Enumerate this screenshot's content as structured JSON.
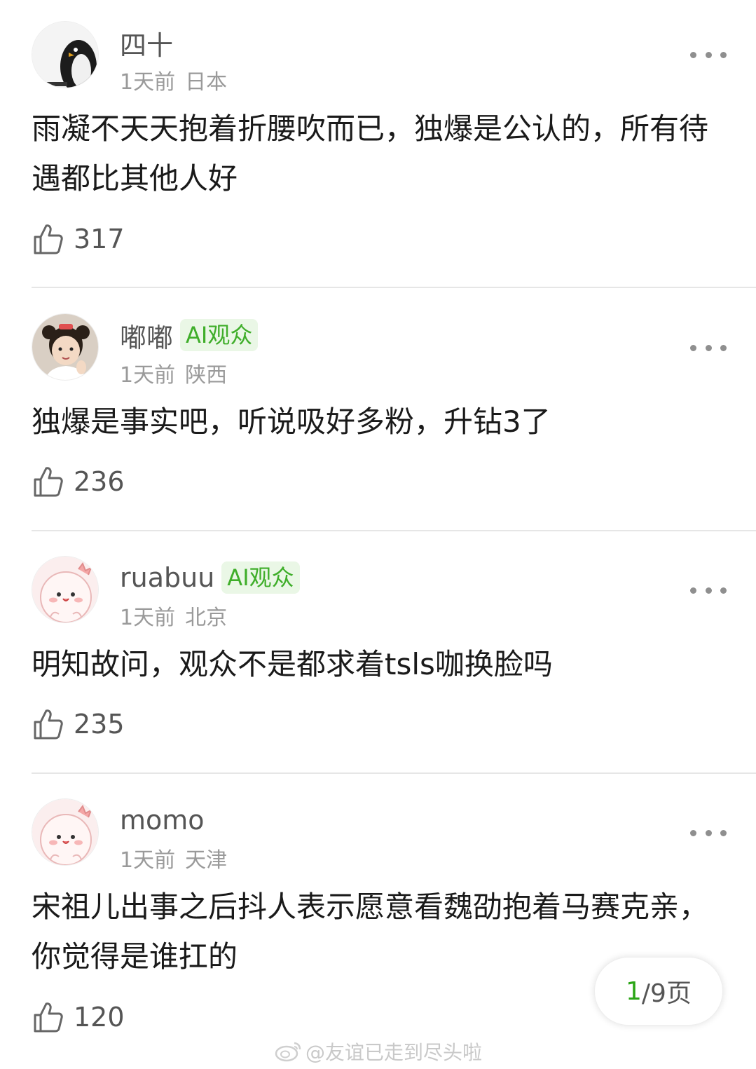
{
  "comments": [
    {
      "username": "四十",
      "badge": "",
      "time": "1天前",
      "location": "日本",
      "content": "雨凝不天天抱着折腰吹而已，独爆是公认的，所有待遇都比其他人好",
      "likes": "317",
      "avatar_icon": "penguin-avatar"
    },
    {
      "username": "嘟嘟",
      "badge": "AI观众",
      "time": "1天前",
      "location": "陕西",
      "content": "独爆是事实吧，听说吸好多粉，升钻3了",
      "likes": "236",
      "avatar_icon": "child-photo-avatar"
    },
    {
      "username": "ruabuu",
      "badge": "AI观众",
      "time": "1天前",
      "location": "北京",
      "content": "明知故问，观众不是都求着tsls咖换脸吗",
      "likes": "235",
      "avatar_icon": "pink-cartoon-avatar"
    },
    {
      "username": "momo",
      "badge": "",
      "time": "1天前",
      "location": "天津",
      "content": "宋祖儿出事之后抖人表示愿意看魏劭抱着马赛克亲，你觉得是谁扛的",
      "likes": "120",
      "avatar_icon": "pink-cartoon-avatar"
    }
  ],
  "pager": {
    "current": "1",
    "total_label": "/9页"
  },
  "watermark": "@友谊已走到尽头啦",
  "colors": {
    "badge_text": "#3fae2a",
    "badge_bg": "#eaf7e6",
    "pager_current": "#2aa515",
    "meta_text": "#9a9a9a"
  }
}
